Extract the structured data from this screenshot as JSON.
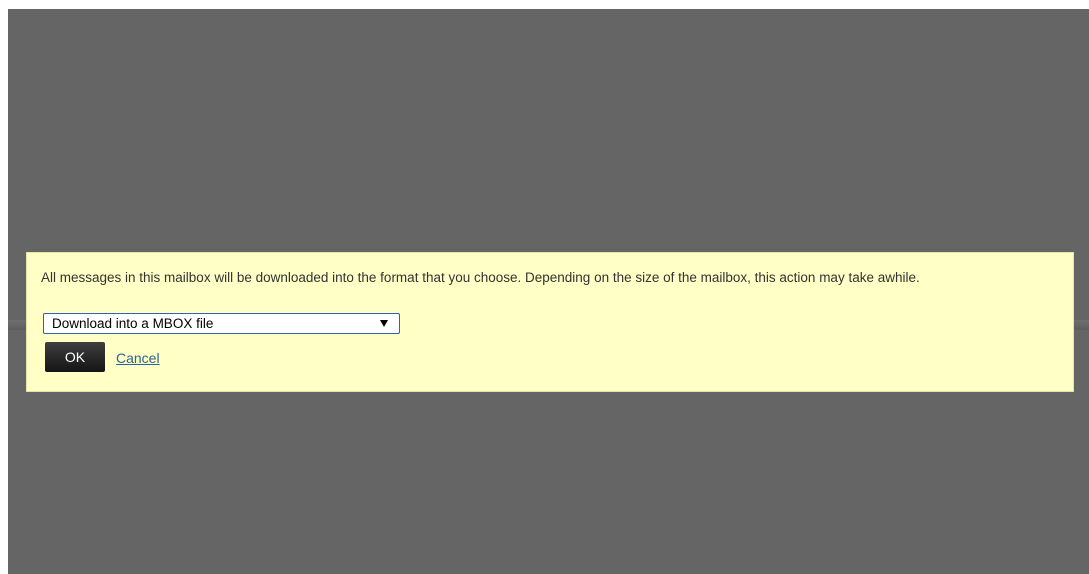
{
  "dialog": {
    "message": "All messages in this mailbox will be downloaded into the format that you choose. Depending on the size of the mailbox, this action may take awhile.",
    "format_select": {
      "selected": "Download into a MBOX file"
    },
    "ok_label": "OK",
    "cancel_label": "Cancel"
  },
  "colors": {
    "overlay": "#656565",
    "dialog_background": "#ffffc6",
    "select_border": "#2b63b5",
    "ok_button": "#1a1a1a",
    "link": "#2a6496"
  },
  "icons": {
    "select_arrow": "triangle-down-icon"
  }
}
